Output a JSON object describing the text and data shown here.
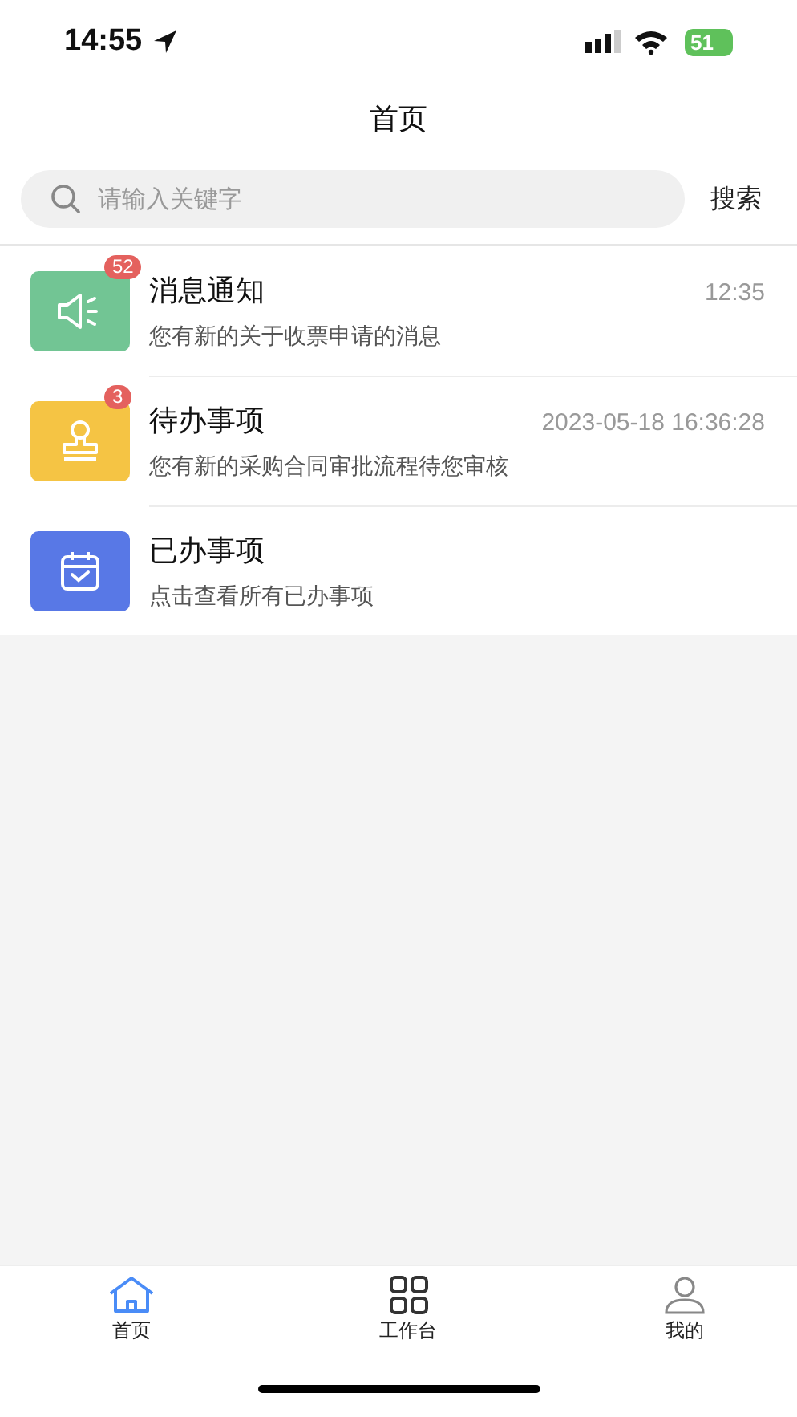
{
  "status_bar": {
    "time": "14:55",
    "battery": "51"
  },
  "title": "首页",
  "search": {
    "placeholder": "请输入关键字",
    "button": "搜索"
  },
  "items": [
    {
      "kind": "megaphone",
      "color": "#72c594",
      "badge": "52",
      "title": "消息通知",
      "time": "12:35",
      "subtitle": "您有新的关于收票申请的消息"
    },
    {
      "kind": "stamp",
      "color": "#f5c444",
      "badge": "3",
      "title": "待办事项",
      "time": "2023-05-18 16:36:28",
      "subtitle": "您有新的采购合同审批流程待您审核"
    },
    {
      "kind": "calendar",
      "color": "#5878e6",
      "title": "已办事项",
      "subtitle": "点击查看所有已办事项"
    }
  ],
  "tabs": [
    {
      "kind": "home",
      "label": "首页",
      "selected": true
    },
    {
      "kind": "grid",
      "label": "工作台",
      "selected": false
    },
    {
      "kind": "person",
      "label": "我的",
      "selected": false
    }
  ]
}
